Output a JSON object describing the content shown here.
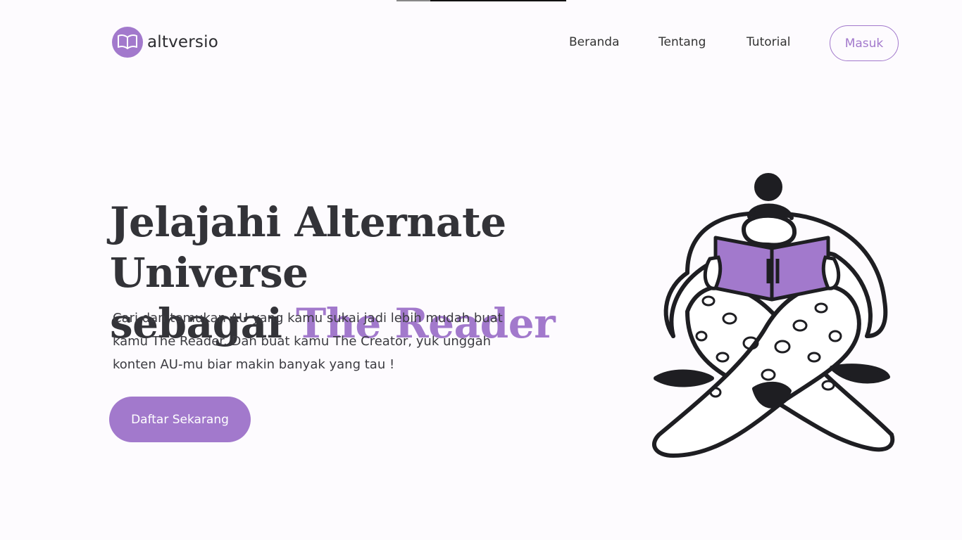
{
  "brand": {
    "name": "altversio",
    "logo_icon": "open-book-icon",
    "color": "#a279cc"
  },
  "nav": {
    "items": [
      {
        "label": "Beranda"
      },
      {
        "label": "Tentang"
      },
      {
        "label": "Tutorial"
      }
    ],
    "login_label": "Masuk"
  },
  "hero": {
    "title_line1": "Jelajahi Alternate Universe",
    "title_line2_prefix": "sebagai ",
    "title_line2_accent": "The Reader",
    "description": "Cari dan temukan AU yang kamu sukai jadi lebih mudah buat kamu The Reader. Dan buat kamu The Creator, yuk unggah konten AU-mu biar makin banyak yang tau !",
    "cta_label": "Daftar Sekarang",
    "illustration": "person-reading-book-illustration"
  },
  "colors": {
    "accent": "#a279cc",
    "background": "#fdfbfe",
    "text": "#333338"
  }
}
